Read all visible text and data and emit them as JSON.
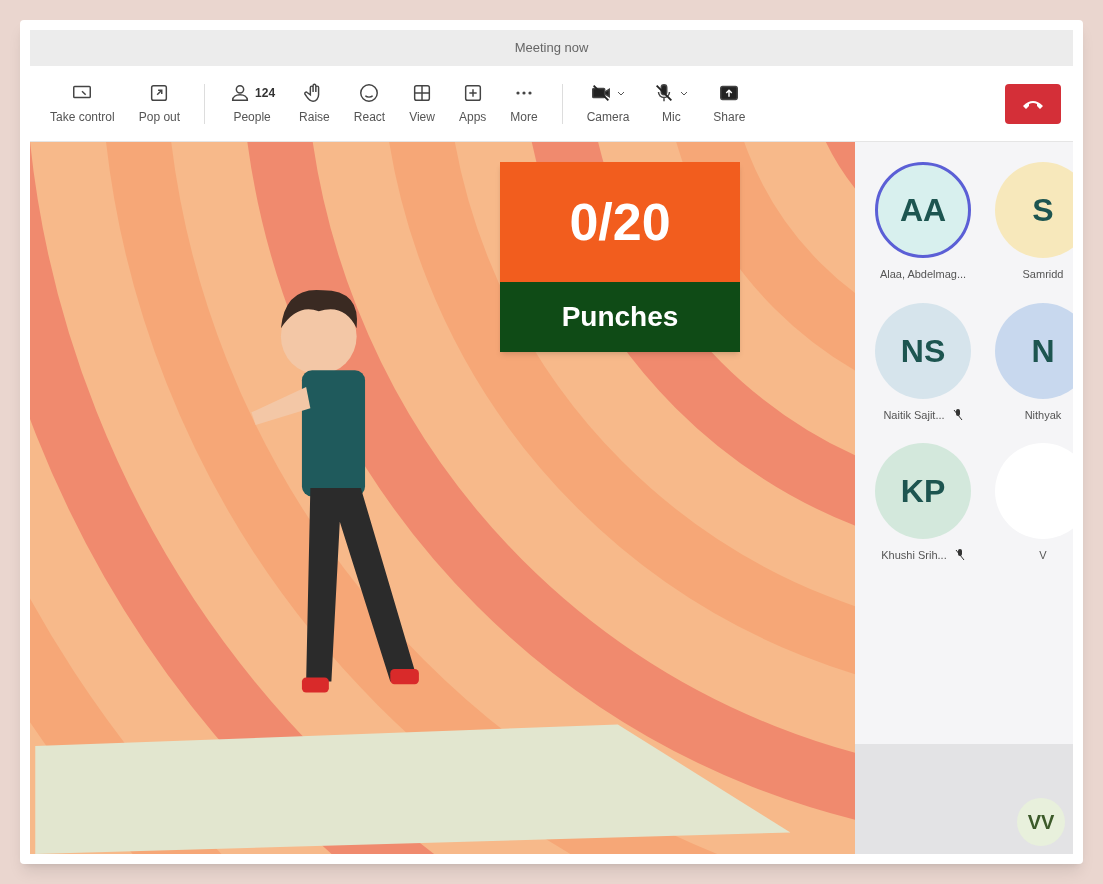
{
  "window": {
    "title": "Meeting now"
  },
  "toolbar": {
    "left": [
      {
        "label": "Take control"
      },
      {
        "label": "Pop out"
      }
    ],
    "middle": [
      {
        "label": "People",
        "count": "124"
      },
      {
        "label": "Raise"
      },
      {
        "label": "React"
      },
      {
        "label": "View"
      },
      {
        "label": "Apps"
      },
      {
        "label": "More"
      }
    ],
    "devices": [
      {
        "label": "Camera",
        "off": true,
        "dropdown": true
      },
      {
        "label": "Mic",
        "off": true,
        "dropdown": true
      },
      {
        "label": "Share",
        "off": false,
        "dropdown": false
      }
    ]
  },
  "stage": {
    "kind": "picture",
    "counter": {
      "value": "0/20",
      "label": "Punches"
    }
  },
  "participants": [
    {
      "initials": "AA",
      "name": "Alaa, Abdelmag...",
      "speaking": true,
      "muted": false,
      "color": "#d8f0ee"
    },
    {
      "initials": "S",
      "name": "Samridd",
      "speaking": false,
      "muted": false,
      "color": "#f7e8bb"
    },
    {
      "initials": "NS",
      "name": "Naitik Sajit...",
      "speaking": false,
      "muted": true,
      "color": "#d6e4ec"
    },
    {
      "initials": "N",
      "name": "Nithyak",
      "speaking": false,
      "muted": false,
      "color": "#c8d8ee"
    },
    {
      "initials": "KP",
      "name": "Khushi Srih...",
      "speaking": false,
      "muted": true,
      "color": "#d3e8dc"
    },
    {
      "name": "V",
      "speaking": false,
      "muted": false,
      "color": "#ffffff"
    }
  ],
  "self_view": {
    "initials": "VV"
  }
}
